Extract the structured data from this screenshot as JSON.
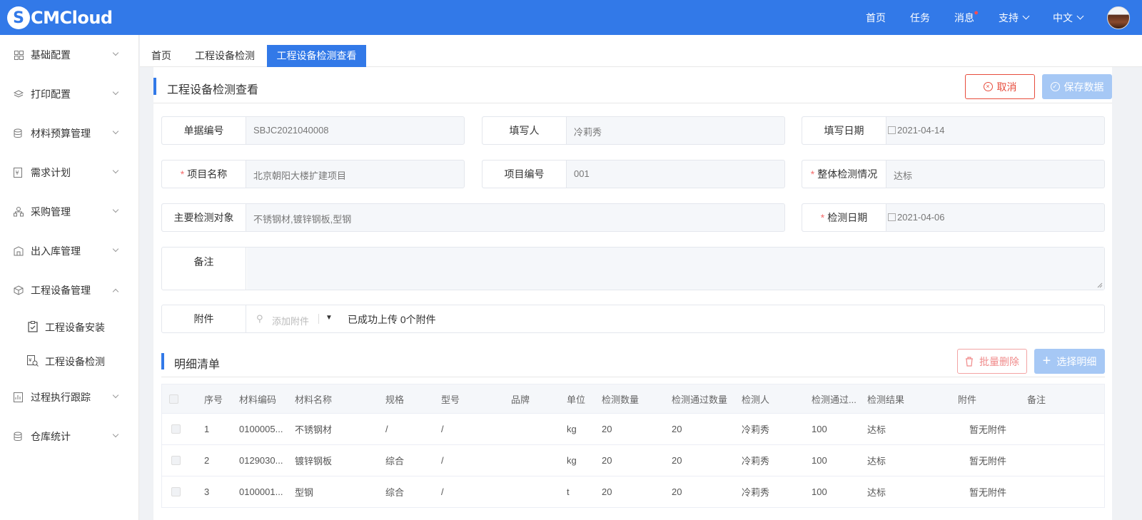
{
  "header": {
    "logo_text": "CMCloud",
    "nav": [
      {
        "label": "首页"
      },
      {
        "label": "任务"
      },
      {
        "label": "消息"
      },
      {
        "label": "支持"
      },
      {
        "label": "中文"
      }
    ]
  },
  "sidebar": {
    "items": [
      {
        "label": "基础配置",
        "icon": "grid-icon"
      },
      {
        "label": "打印配置",
        "icon": "layers-icon"
      },
      {
        "label": "材料预算管理",
        "icon": "database-icon"
      },
      {
        "label": "需求计划",
        "icon": "money-doc-icon"
      },
      {
        "label": "采购管理",
        "icon": "org-icon"
      },
      {
        "label": "出入库管理",
        "icon": "building-icon"
      },
      {
        "label": "工程设备管理",
        "icon": "box-icon"
      },
      {
        "label": "过程执行跟踪",
        "icon": "chart-doc-icon"
      },
      {
        "label": "仓库统计",
        "icon": "database-icon"
      }
    ],
    "sub_items": [
      {
        "label": "工程设备安装",
        "icon": "clipboard-check-icon"
      },
      {
        "label": "工程设备检测",
        "icon": "money-search-icon"
      }
    ]
  },
  "tabs": [
    {
      "label": "首页"
    },
    {
      "label": "工程设备检测"
    },
    {
      "label": "工程设备检测查看"
    }
  ],
  "page": {
    "title": "工程设备检测查看",
    "cancel_label": "取消",
    "save_label": "保存数据"
  },
  "form": {
    "doc_no": {
      "label": "单据编号",
      "value": "SBJC2021040008"
    },
    "writer": {
      "label": "填写人",
      "value": "冷莉秀"
    },
    "write_date": {
      "label": "填写日期",
      "value": "2021-04-14"
    },
    "project_name": {
      "label": "项目名称",
      "value": "北京朝阳大楼扩建项目"
    },
    "project_no": {
      "label": "项目编号",
      "value": "001"
    },
    "overall": {
      "label": "整体检测情况",
      "value": "达标"
    },
    "main_objects": {
      "label": "主要检测对象",
      "value": "不锈钢材,镀锌钢板,型钢"
    },
    "check_date": {
      "label": "检测日期",
      "value": "2021-04-06"
    },
    "remark": {
      "label": "备注",
      "value": ""
    },
    "attach": {
      "label": "附件",
      "placeholder": "添加附件",
      "status": "已成功上传 0个附件"
    }
  },
  "detail": {
    "title": "明细清单",
    "batch_delete": "批量删除",
    "select_detail": "选择明细",
    "columns": [
      "序号",
      "材料编码",
      "材料名称",
      "规格",
      "型号",
      "品牌",
      "单位",
      "检测数量",
      "检测通过数量",
      "检测人",
      "检测通过...",
      "检测结果",
      "附件",
      "备注"
    ],
    "rows": [
      [
        "1",
        "0100005...",
        "不锈钢材",
        "/",
        "/",
        "",
        "kg",
        "20",
        "20",
        "冷莉秀",
        "100",
        "达标",
        "暂无附件",
        ""
      ],
      [
        "2",
        "0129030...",
        "镀锌钢板",
        "综合",
        "/",
        "",
        "kg",
        "20",
        "20",
        "冷莉秀",
        "100",
        "达标",
        "暂无附件",
        ""
      ],
      [
        "3",
        "0100001...",
        "型钢",
        "综合",
        "/",
        "",
        "t",
        "20",
        "20",
        "冷莉秀",
        "100",
        "达标",
        "暂无附件",
        ""
      ]
    ]
  }
}
